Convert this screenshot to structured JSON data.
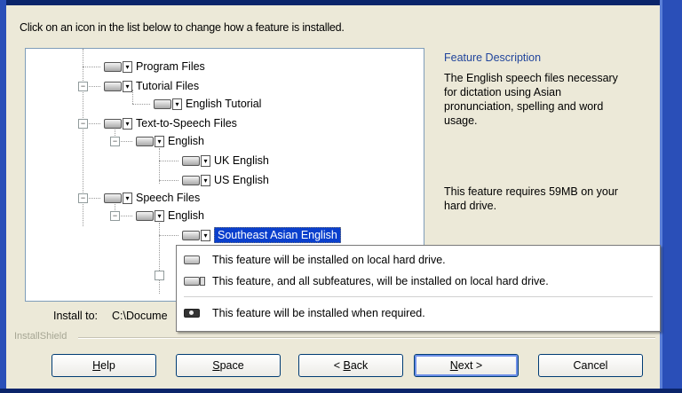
{
  "instruction": "Click on an icon in the list below to change how a feature is installed.",
  "tree": {
    "items": [
      {
        "label": "Program Files",
        "level": 1,
        "expander": ""
      },
      {
        "label": "Tutorial Files",
        "level": 1,
        "expander": "−"
      },
      {
        "label": "English Tutorial",
        "level": 2,
        "expander": ""
      },
      {
        "label": "Text-to-Speech Files",
        "level": 1,
        "expander": "−"
      },
      {
        "label": "English",
        "level": 2,
        "expander": "−"
      },
      {
        "label": "UK English",
        "level": 3,
        "expander": ""
      },
      {
        "label": "US English",
        "level": 3,
        "expander": ""
      },
      {
        "label": "Speech Files",
        "level": 1,
        "expander": "−"
      },
      {
        "label": "English",
        "level": 2,
        "expander": "−"
      },
      {
        "label": "Southeast Asian English",
        "level": 3,
        "expander": "",
        "selected": true
      }
    ],
    "scroll_up_glyph": "▲"
  },
  "feature_description": {
    "title": "Feature Description",
    "text": "The English speech files necessary for dictation using Asian pronunciation, spelling and word usage.",
    "requirement": "This feature requires 59MB on your hard drive."
  },
  "install_to": {
    "label": "Install to:",
    "path": "C:\\Docume"
  },
  "brand": "InstallShield",
  "popup_menu": {
    "items": [
      {
        "label": "This feature will be installed on local hard drive.",
        "icon": "hard-drive-icon"
      },
      {
        "label": "This feature, and all subfeatures, will be installed on local hard drive.",
        "icon": "hard-drive-subfeatures-icon"
      },
      {
        "label": "This feature will be installed when required.",
        "icon": "install-on-demand-icon"
      }
    ]
  },
  "buttons": {
    "help": {
      "prefix": "",
      "accel": "H",
      "rest": "elp"
    },
    "space": {
      "prefix": "",
      "accel": "S",
      "rest": "pace"
    },
    "back": {
      "prefix": "< ",
      "accel": "B",
      "rest": "ack"
    },
    "next": {
      "prefix": "",
      "accel": "N",
      "rest": "ext >"
    },
    "cancel": {
      "prefix": "",
      "accel": "",
      "rest": "Cancel"
    }
  },
  "colors": {
    "accent": "#0a3fcd",
    "link_title": "#21459c",
    "dialog_bg": "#ece9d8"
  }
}
